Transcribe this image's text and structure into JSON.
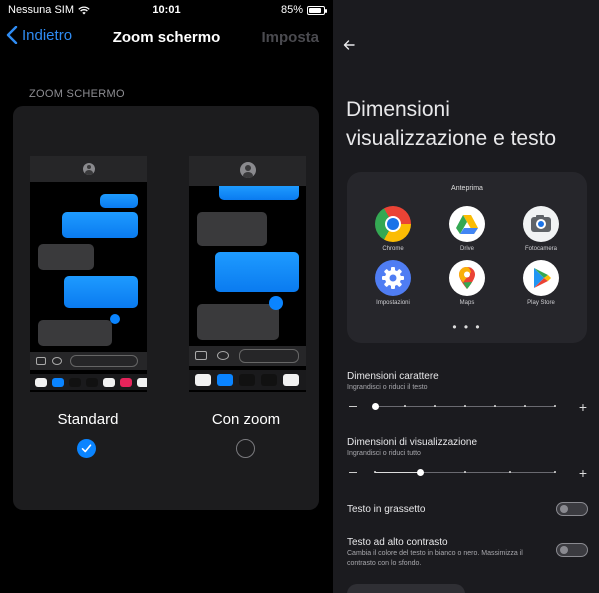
{
  "ios": {
    "status": {
      "carrier": "Nessuna SIM",
      "time": "10:01",
      "battery": "85%",
      "battery_level": 0.85
    },
    "nav": {
      "back_label": "Indietro",
      "title": "Zoom schermo",
      "action_label": "Imposta"
    },
    "section_header": "ZOOM SCHERMO",
    "options": [
      {
        "label": "Standard",
        "selected": true
      },
      {
        "label": "Con zoom",
        "selected": false
      }
    ],
    "colors": {
      "accent": "#0a84ff",
      "card": "#1c1c1e",
      "bubble_blue": "#0a84ff",
      "bubble_gray": "#3a3a3c"
    }
  },
  "android": {
    "title": "Dimensioni visualizzazione e testo",
    "preview": {
      "label": "Anteprima",
      "apps": [
        {
          "label": "Chrome",
          "icon": "chrome-icon"
        },
        {
          "label": "Drive",
          "icon": "drive-icon"
        },
        {
          "label": "Fotocamera",
          "icon": "camera-icon"
        },
        {
          "label": "Impostazioni",
          "icon": "settings-gear-icon"
        },
        {
          "label": "Maps",
          "icon": "maps-icon"
        },
        {
          "label": "Play Store",
          "icon": "play-store-icon"
        }
      ],
      "more": "• • •"
    },
    "font_size": {
      "title": "Dimensioni carattere",
      "subtitle": "Ingrandisci o riduci il testo",
      "level": 0,
      "steps": 7
    },
    "display_size": {
      "title": "Dimensioni di visualizzazione",
      "subtitle": "Ingrandisci o riduci tutto",
      "level": 1,
      "steps": 5
    },
    "bold_text": {
      "title": "Testo in grassetto",
      "enabled": false
    },
    "high_contrast": {
      "title": "Testo ad alto contrasto",
      "subtitle": "Cambia il colore del testo in bianco o nero. Massimizza il contrasto con lo sfondo.",
      "enabled": false
    },
    "colors": {
      "background": "#1b1b1f",
      "surface": "#26262b"
    }
  }
}
